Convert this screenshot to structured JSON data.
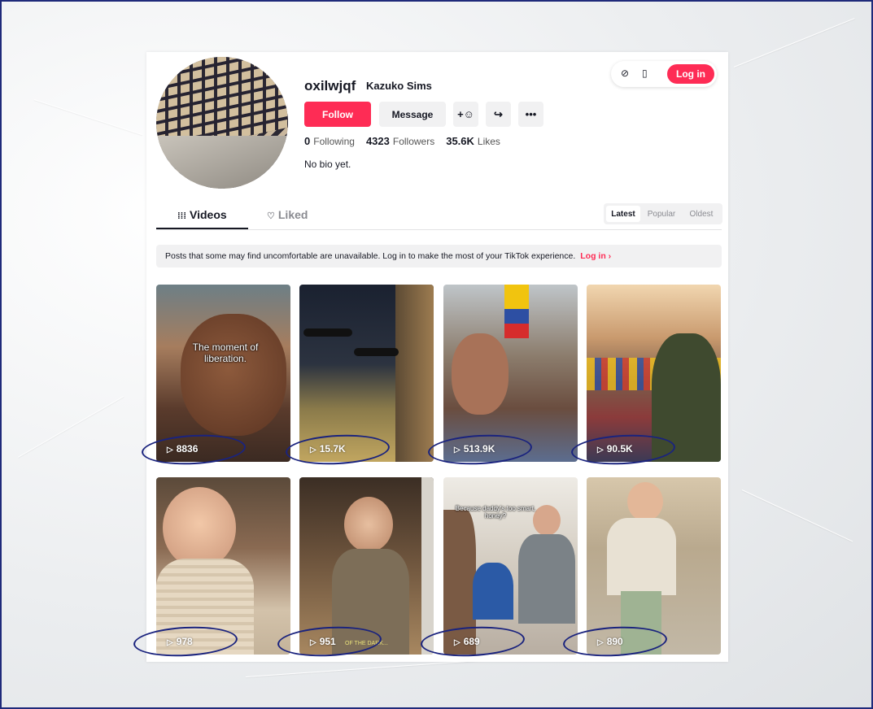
{
  "profile": {
    "username": "oxilwjqf",
    "nickname": "Kazuko Sims",
    "follow_label": "Follow",
    "message_label": "Message",
    "following_count": "0",
    "following_label": "Following",
    "followers_count": "4323",
    "followers_label": "Followers",
    "likes_count": "35.6K",
    "likes_label": "Likes",
    "bio": "No bio yet."
  },
  "header": {
    "login_label": "Log in"
  },
  "tabs": {
    "videos": "Videos",
    "liked": "Liked"
  },
  "sort": {
    "latest": "Latest",
    "popular": "Popular",
    "oldest": "Oldest",
    "selected": "Latest"
  },
  "notice": {
    "text": "Posts that some may find uncomfortable are unavailable. Log in to make the most of your TikTok experience.",
    "link": "Log in"
  },
  "videos": [
    {
      "views": "8836",
      "caption": "The moment of liberation."
    },
    {
      "views": "15.7K"
    },
    {
      "views": "513.9K"
    },
    {
      "views": "90.5K"
    },
    {
      "views": "978"
    },
    {
      "views": "951",
      "overlay": "OF THE DARK..."
    },
    {
      "views": "689",
      "caption": "Because daddy's too smart, honey?"
    },
    {
      "views": "890"
    }
  ],
  "colors": {
    "brand": "#fe2c55",
    "annotation": "#1a237e"
  }
}
